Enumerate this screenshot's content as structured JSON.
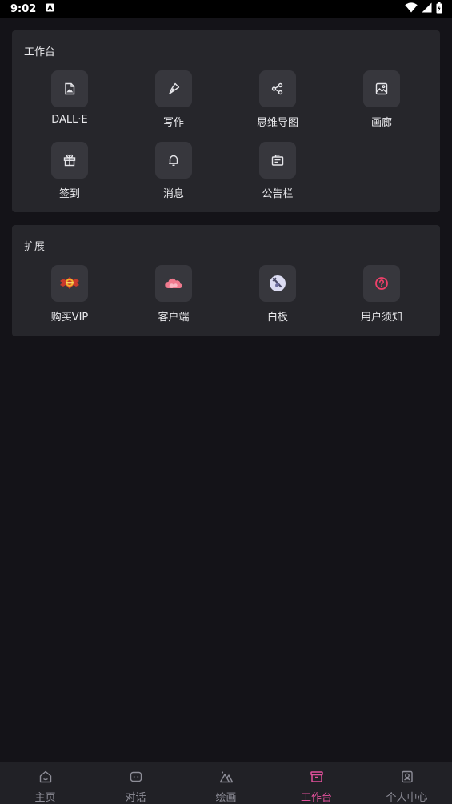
{
  "status": {
    "time": "9:02"
  },
  "workbench": {
    "title": "工作台",
    "items": [
      {
        "label": "DALL·E",
        "icon": "image-icon"
      },
      {
        "label": "写作",
        "icon": "pen-icon"
      },
      {
        "label": "思维导图",
        "icon": "mindmap-icon"
      },
      {
        "label": "画廊",
        "icon": "gallery-icon"
      },
      {
        "label": "签到",
        "icon": "gift-icon"
      },
      {
        "label": "消息",
        "icon": "bell-icon"
      },
      {
        "label": "公告栏",
        "icon": "bulletin-icon"
      }
    ]
  },
  "extensions": {
    "title": "扩展",
    "items": [
      {
        "label": "购买VIP",
        "icon": "vip-badge-icon"
      },
      {
        "label": "客户端",
        "icon": "cloud-icon"
      },
      {
        "label": "白板",
        "icon": "whiteboard-icon"
      },
      {
        "label": "用户须知",
        "icon": "question-icon"
      }
    ]
  },
  "tabs": [
    {
      "label": "主页",
      "icon": "home-icon",
      "active": false
    },
    {
      "label": "对话",
      "icon": "chat-icon",
      "active": false
    },
    {
      "label": "绘画",
      "icon": "mountain-icon",
      "active": false
    },
    {
      "label": "工作台",
      "icon": "archive-icon",
      "active": true
    },
    {
      "label": "个人中心",
      "icon": "profile-icon",
      "active": false
    }
  ],
  "colors": {
    "accent": "#e2519c",
    "background": "#141318",
    "panel": "#26262b",
    "tile": "#37373d"
  }
}
